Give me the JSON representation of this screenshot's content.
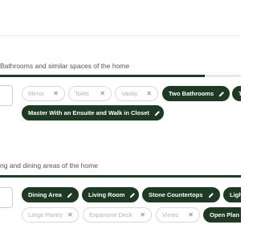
{
  "sections": [
    {
      "title": "Bathrooms and similar spaces of the home",
      "progress": 0.85,
      "chips": [
        {
          "label": "Mirror",
          "state": "inactive",
          "icon": "close-icon"
        },
        {
          "label": "Toilet",
          "state": "inactive",
          "icon": "close-icon"
        },
        {
          "label": "Vanity",
          "state": "inactive",
          "icon": "close-icon"
        },
        {
          "label": "Two Bathrooms",
          "state": "active",
          "icon": "pencil-icon"
        },
        {
          "label": "T",
          "state": "active",
          "icon": ""
        },
        {
          "label": "Master With an Ensuite and Walk in Closet",
          "state": "active",
          "icon": "pencil-icon"
        }
      ]
    },
    {
      "title": "ng and dining areas of the home",
      "progress": 1.0,
      "chips": [
        {
          "label": "Dining Area",
          "state": "active",
          "icon": "pencil-icon"
        },
        {
          "label": "Living Room",
          "state": "active",
          "icon": "pencil-icon"
        },
        {
          "label": "Stone Countertops",
          "state": "active",
          "icon": "pencil-icon"
        },
        {
          "label": "Ligh",
          "state": "active",
          "icon": ""
        },
        {
          "label": "Large Pantry",
          "state": "inactive",
          "icon": "close-icon"
        },
        {
          "label": "Expansive Deck",
          "state": "inactive",
          "icon": "close-icon"
        },
        {
          "label": "Views",
          "state": "inactive",
          "icon": "close-icon"
        },
        {
          "label": "Open Plan L",
          "state": "active",
          "icon": ""
        }
      ]
    }
  ],
  "colors": {
    "accent": "#1e3a25",
    "track": "#e6e9e6",
    "inactive_text": "#b3b3b3"
  }
}
